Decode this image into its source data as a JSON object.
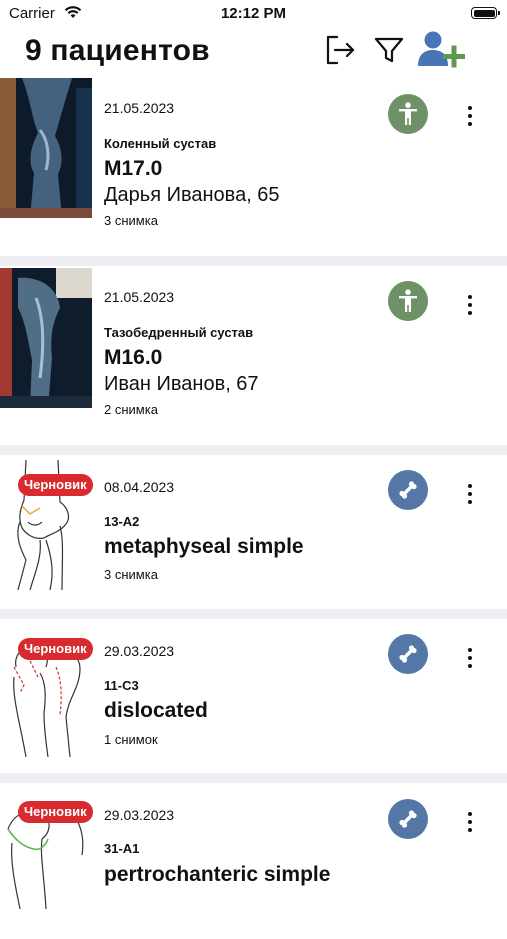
{
  "status_bar": {
    "carrier": "Carrier",
    "time": "12:12 PM"
  },
  "header": {
    "title": "9 пациентов",
    "icons": [
      "exit-icon",
      "filter-icon",
      "add-patient-icon"
    ],
    "accent_color": "#4a74b8",
    "add_plus_color": "#5e9a4e"
  },
  "colors": {
    "draft_badge": "#d82a2f",
    "type_green": "#6e9265",
    "type_blue": "#5577a8",
    "separator": "#efeff3"
  },
  "patients": [
    {
      "date": "21.05.2023",
      "region": "Коленный сустав",
      "code": "M17.0",
      "patient": "Дарья Иванова, 65",
      "images": "3 снимка",
      "type_icon": "person-icon",
      "draft": ""
    },
    {
      "date": "21.05.2023",
      "region": "Тазобедренный сустав",
      "code": "M16.0",
      "patient": "Иван Иванов, 67",
      "images": "2 снимка",
      "type_icon": "person-icon",
      "draft": ""
    },
    {
      "date": "08.04.2023",
      "code": "13-A2",
      "title": "metaphyseal simple",
      "images": "3 снимка",
      "type_icon": "bone-icon",
      "draft": "Черновик"
    },
    {
      "date": "29.03.2023",
      "code": "11-C3",
      "title": "dislocated",
      "images": "1 снимок",
      "type_icon": "bone-icon",
      "draft": "Черновик"
    },
    {
      "date": "29.03.2023",
      "code": "31-A1",
      "title": "pertrochanteric simple",
      "images": "",
      "type_icon": "bone-icon",
      "draft": "Черновик"
    }
  ]
}
